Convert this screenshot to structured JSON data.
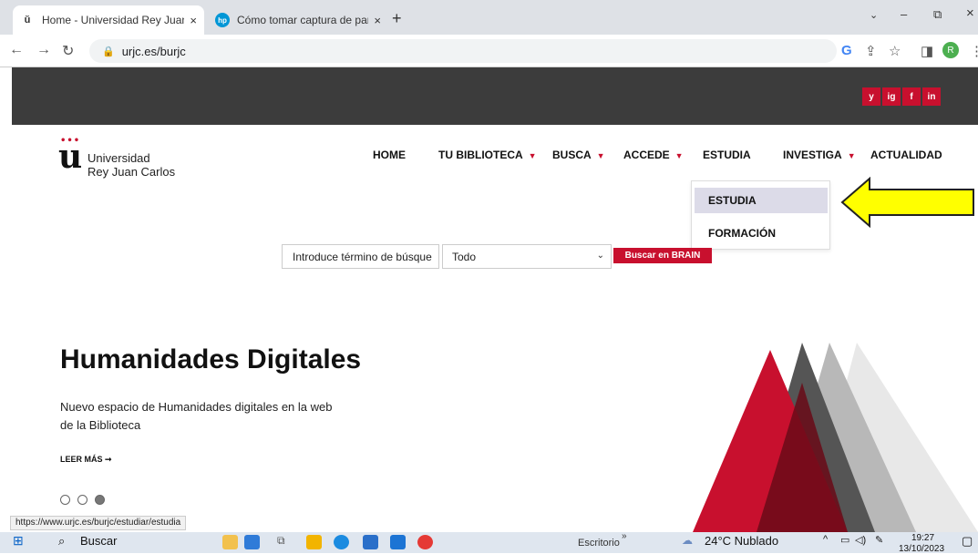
{
  "browser": {
    "tabs": [
      {
        "title": "Home - Universidad Rey Juan Ca",
        "close": "×",
        "active": true
      },
      {
        "title": "Cómo tomar captura de pantalla",
        "close": "×",
        "active": false
      }
    ],
    "new_tab": "+",
    "url": "urjc.es/burjc",
    "profile_initial": "R",
    "window_controls": {
      "minimize": "–",
      "restore": "⧉",
      "close": "×"
    }
  },
  "site": {
    "social": [
      "y",
      "ig",
      "f",
      "in"
    ],
    "logo": {
      "line1": "Universidad",
      "line2": "Rey Juan Carlos"
    },
    "nav": [
      {
        "label": "HOME",
        "has_caret": false
      },
      {
        "label": "TU BIBLIOTECA",
        "has_caret": true
      },
      {
        "label": "BUSCA",
        "has_caret": true
      },
      {
        "label": "ACCEDE",
        "has_caret": true
      },
      {
        "label": "ESTUDIA",
        "has_caret": false
      },
      {
        "label": "INVESTIGA",
        "has_caret": true
      },
      {
        "label": "ACTUALIDAD",
        "has_caret": false
      }
    ],
    "dropdown": [
      {
        "label": "ESTUDIA",
        "highlighted": true
      },
      {
        "label": "FORMACIÓN",
        "highlighted": false
      }
    ],
    "search": {
      "placeholder": "Introduce término de búsque",
      "select_value": "Todo",
      "button": "Buscar en BRAIN"
    },
    "hero": {
      "title": "Humanidades Digitales",
      "description": "Nuevo espacio de Humanidades digitales en la web de la Biblioteca",
      "more": "LEER MÁS ➞",
      "slides": 3,
      "active_slide": 3
    },
    "colors": {
      "brand_red": "#c8102e",
      "dark_band": "#3c3c3c",
      "arrow_yellow": "#ffff00"
    }
  },
  "status_url": "https://www.urjc.es/burjc/estudiar/estudia",
  "taskbar": {
    "search_label": "Buscar",
    "desktop_label": "Escritorio",
    "weather": "24°C  Nublado",
    "time": "19:27",
    "date": "13/10/2023"
  }
}
